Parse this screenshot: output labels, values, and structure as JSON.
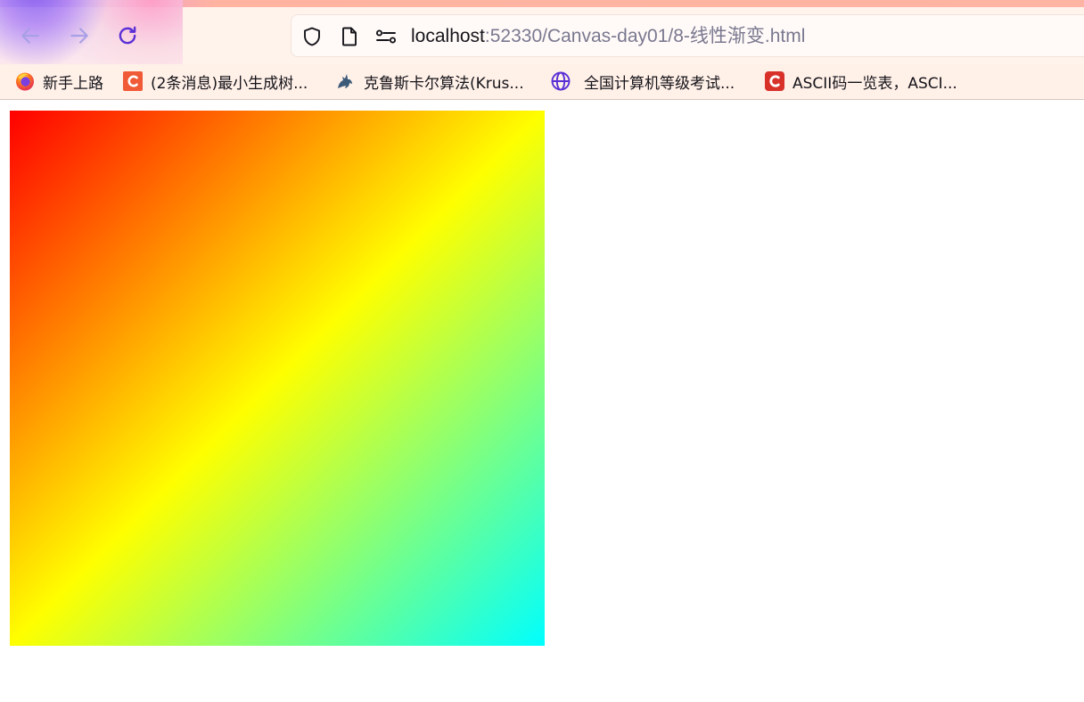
{
  "toolbar": {
    "back_label": "Back",
    "forward_label": "Forward",
    "reload_label": "Reload"
  },
  "urlbar": {
    "host": "localhost",
    "path": ":52330/Canvas-day01/8-线性渐变.html"
  },
  "bookmarks": [
    {
      "label": "新手上路",
      "icon": "firefox-icon"
    },
    {
      "label": "(2条消息)最小生成树...",
      "icon": "csdn-icon"
    },
    {
      "label": "克鲁斯卡尔算法(Krus...",
      "icon": "unicorn-icon"
    },
    {
      "label": "全国计算机等级考试...",
      "icon": "globe-icon"
    },
    {
      "label": "ASCII码一览表，ASCI...",
      "icon": "c-logo-icon"
    }
  ],
  "canvas": {
    "gradient_stops": [
      {
        "offset": 0,
        "color": "#ff0000"
      },
      {
        "offset": 0.5,
        "color": "#ffff00"
      },
      {
        "offset": 1,
        "color": "#00ffff"
      }
    ]
  },
  "colors": {
    "accent": "#5b2fd6",
    "chrome_background": "#fff3ec"
  }
}
